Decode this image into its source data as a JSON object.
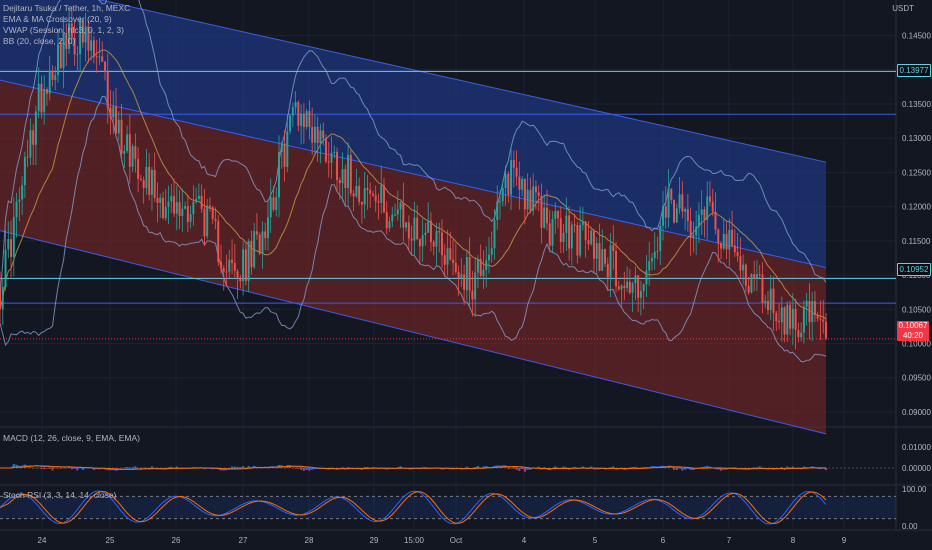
{
  "chart_data": {
    "type": "candlestick",
    "symbol": "Dejitaru Tsuka / Tether, 1h, MEXC",
    "currency": "USDT",
    "indicators": [
      "EMA & MA Crossover (20, 9)",
      "VWAP (Session, hlc3, 0, 1, 2, 3)",
      "BB (20, close, 2, 0)"
    ],
    "price_axis": {
      "ticks": [
        "0.14500",
        "0.14000",
        "0.13500",
        "0.13000",
        "0.12500",
        "0.12000",
        "0.11500",
        "0.11000",
        "0.10500",
        "0.10000",
        "0.09500",
        "0.09000"
      ],
      "ylim": [
        0.0878,
        0.1502
      ]
    },
    "x_axis": {
      "ticks": [
        "24",
        "25",
        "26",
        "27",
        "28",
        "29",
        "15:00",
        "Oct",
        "4",
        "5",
        "6",
        "7",
        "8",
        "9"
      ]
    },
    "horizontal_lines": [
      0.13977,
      0.10952
    ],
    "current_price": "0.10067",
    "countdown": "40:20",
    "channel": {
      "upper_start": 0.1535,
      "upper_end": 0.1265,
      "mid_start": 0.1385,
      "mid_end": 0.1111,
      "lower_start": 0.1165,
      "lower_end": 0.0868
    },
    "close_path": [
      0.108,
      0.121,
      0.136,
      0.143,
      0.145,
      0.141,
      0.131,
      0.127,
      0.122,
      0.119,
      0.121,
      0.115,
      0.109,
      0.114,
      0.123,
      0.135,
      0.131,
      0.127,
      0.124,
      0.121,
      0.119,
      0.116,
      0.117,
      0.112,
      0.109,
      0.115,
      0.126,
      0.121,
      0.117,
      0.116,
      0.115,
      0.112,
      0.108,
      0.11,
      0.12,
      0.118,
      0.121,
      0.114,
      0.11,
      0.107,
      0.103,
      0.1045,
      0.10067
    ],
    "macd": {
      "label": "MACD (12, 26, close, 9, EMA, EMA)",
      "ticks": [
        "0.01000",
        "0.00000"
      ]
    },
    "stoch_rsi": {
      "label": "Stoch RSI (3, 3, 14, 14, close)",
      "ticks": [
        "100.00",
        "0.00"
      ],
      "bands": [
        80,
        20
      ]
    }
  },
  "colors": {
    "background": "#131722",
    "channel_upper": "#1e3a8a",
    "channel_lower": "#7a2626",
    "channel_line": "#3b5ee8",
    "up": "#26a69a",
    "down": "#ef5350",
    "bb": "#8ea6d8",
    "hline": "#5fd3e6",
    "last": "#f23645",
    "ema": "#d8a24a"
  }
}
